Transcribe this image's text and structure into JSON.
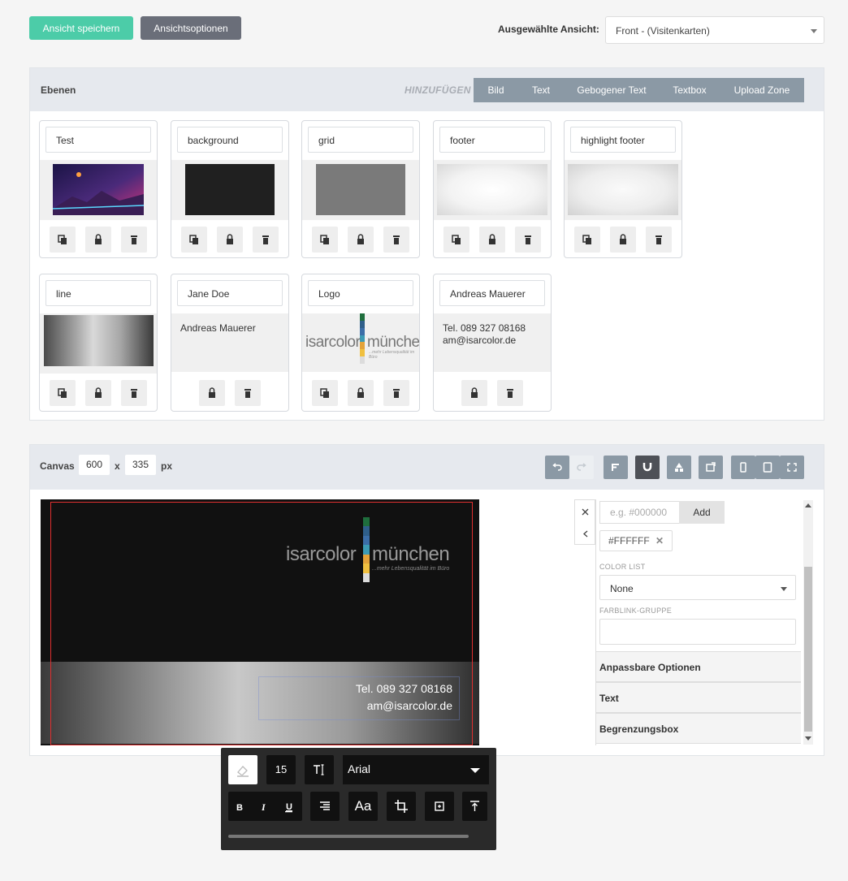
{
  "toolbar": {
    "save_label": "Ansicht speichern",
    "options_label": "Ansichtsoptionen",
    "view_label": "Ausgewählte Ansicht:",
    "view_value": "Front - (Visitenkarten)"
  },
  "layers": {
    "title": "Ebenen",
    "add_label": "HINZUFÜGEN",
    "add_tabs": [
      "Bild",
      "Text",
      "Gebogener Text",
      "Textbox",
      "Upload Zone"
    ],
    "items": [
      {
        "name": "Test",
        "preview": "image"
      },
      {
        "name": "background",
        "preview": "color"
      },
      {
        "name": "grid",
        "preview": "color"
      },
      {
        "name": "footer",
        "preview": "gradient"
      },
      {
        "name": "highlight footer",
        "preview": "gradient"
      },
      {
        "name": "line",
        "preview": "gradient"
      },
      {
        "name": "Jane Doe",
        "preview": "text",
        "text": "Andreas Mauerer"
      },
      {
        "name": "Logo",
        "preview": "logo"
      },
      {
        "name": "Andreas Mauerer",
        "preview": "text",
        "text": "Tel. 089 327 08168\nam@isarcolor.de"
      }
    ]
  },
  "logo": {
    "left_word": "isarcolor",
    "right_word": "münchen",
    "tagline": "...mehr Lebensqualität im Büro",
    "stripe_colors": [
      "#1f6e3d",
      "#2f5f8a",
      "#3b6ea8",
      "#3c9bb5",
      "#e3a33a",
      "#f0c040",
      "#dcdcdc"
    ]
  },
  "canvas": {
    "label": "Canvas",
    "width": "600",
    "x": "x",
    "height": "335",
    "unit": "px",
    "phone": "Tel. 089 327 08168",
    "email": "am@isarcolor.de"
  },
  "side": {
    "color_placeholder": "e.g. #000000",
    "add_label": "Add",
    "chip_value": "#FFFFFF",
    "color_list_label": "COLOR LIST",
    "color_list_value": "None",
    "group_label": "FARBLINK-GRUPPE",
    "acc1": "Anpassbare Optionen",
    "acc2": "Text",
    "acc3": "Begrenzungsbox"
  },
  "floating": {
    "font_size": "15",
    "font_name": "Arial",
    "case_label": "Aa"
  }
}
